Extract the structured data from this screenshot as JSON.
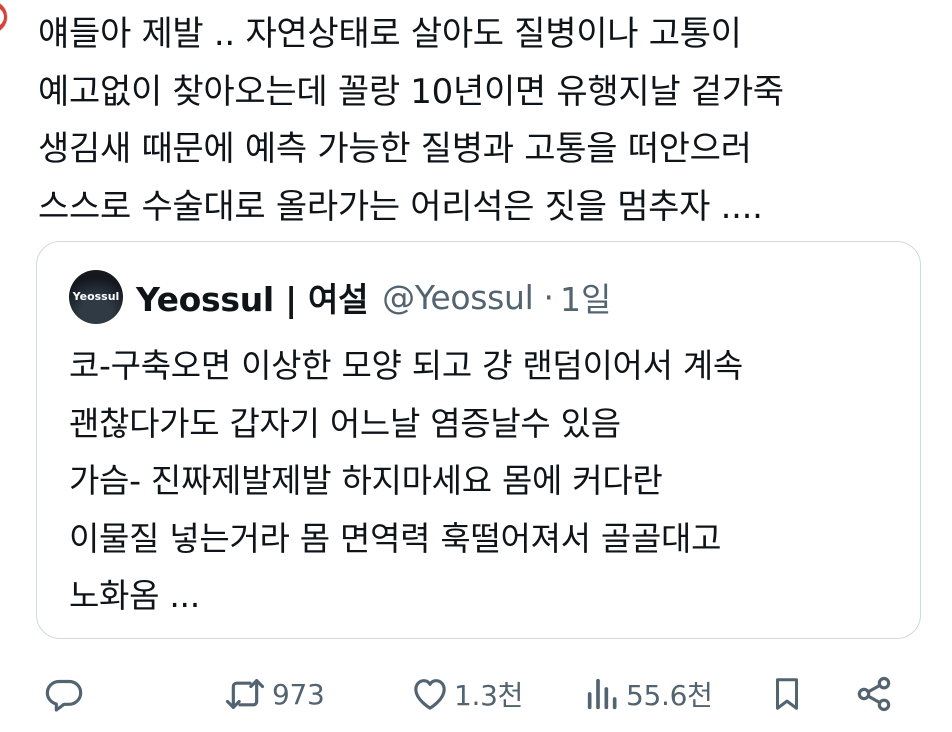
{
  "tweet": {
    "text": "얘들아 제발 .. 자연상태로 살아도 질병이나 고통이\n예고없이 찾아오는데 꼴랑 10년이면 유행지날 겉가죽\n생김새 때문에 예측 가능한 질병과 고통을 떠안으러\n스스로 수술대로 올라가는 어리석은 짓을 멈추자 ...."
  },
  "quote": {
    "avatar_text": "Yeossul",
    "display_name": "Yeossul | 여설",
    "handle": "@Yeossul",
    "separator": "·",
    "time": "1일",
    "text": "코-구축오면 이상한 모양 되고 걍 랜덤이어서 계속\n괜찮다가도 갑자기 어느날 염증날수 있음\n가슴- 진짜제발제발 하지마세요 몸에 커다란\n이물질 넣는거라 몸 면역력 훅떨어져서 골골대고\n노화옴 ..."
  },
  "actions": {
    "reply": {
      "icon": "reply-icon"
    },
    "repost": {
      "icon": "repost-icon",
      "count": "973"
    },
    "like": {
      "icon": "heart-icon",
      "count": "1.3천"
    },
    "views": {
      "icon": "views-icon",
      "count": "55.6천"
    },
    "bookmark": {
      "icon": "bookmark-icon"
    },
    "share": {
      "icon": "share-icon"
    }
  },
  "colors": {
    "text": "#0f1419",
    "secondary": "#536471",
    "border": "#cfd9de"
  }
}
